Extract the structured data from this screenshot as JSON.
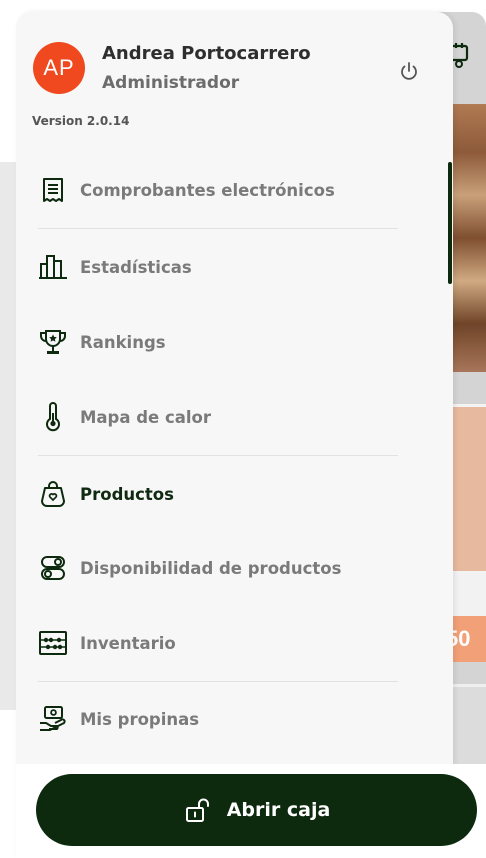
{
  "profile": {
    "initials": "AP",
    "name": "Andrea Portocarrero",
    "role": "Administrador",
    "avatar_color": "#f0481f"
  },
  "version": "Version 2.0.14",
  "menu": [
    {
      "label": "Comprobantes electrónicos",
      "icon": "receipt-icon",
      "active": false
    },
    {
      "label": "Estadísticas",
      "icon": "bar-chart-icon",
      "active": false
    },
    {
      "label": "Rankings",
      "icon": "trophy-icon",
      "active": false
    },
    {
      "label": "Mapa de calor",
      "icon": "thermometer-icon",
      "active": false
    },
    {
      "label": "Productos",
      "icon": "shopping-bag-icon",
      "active": true
    },
    {
      "label": "Disponibilidad de productos",
      "icon": "toggle-stack-icon",
      "active": false
    },
    {
      "label": "Inventario",
      "icon": "abacus-icon",
      "active": false
    },
    {
      "label": "Mis propinas",
      "icon": "tip-hand-icon",
      "active": false
    }
  ],
  "open_register": {
    "label": "Abrir caja",
    "icon": "unlock-icon"
  },
  "background": {
    "price_fragment": "50"
  },
  "colors": {
    "primary": "#0d2a0f",
    "active_text": "#0f2a10",
    "inactive_text": "#7a7a7a",
    "drawer_bg": "#f7f7f7",
    "price_tag": "#f1a077"
  }
}
